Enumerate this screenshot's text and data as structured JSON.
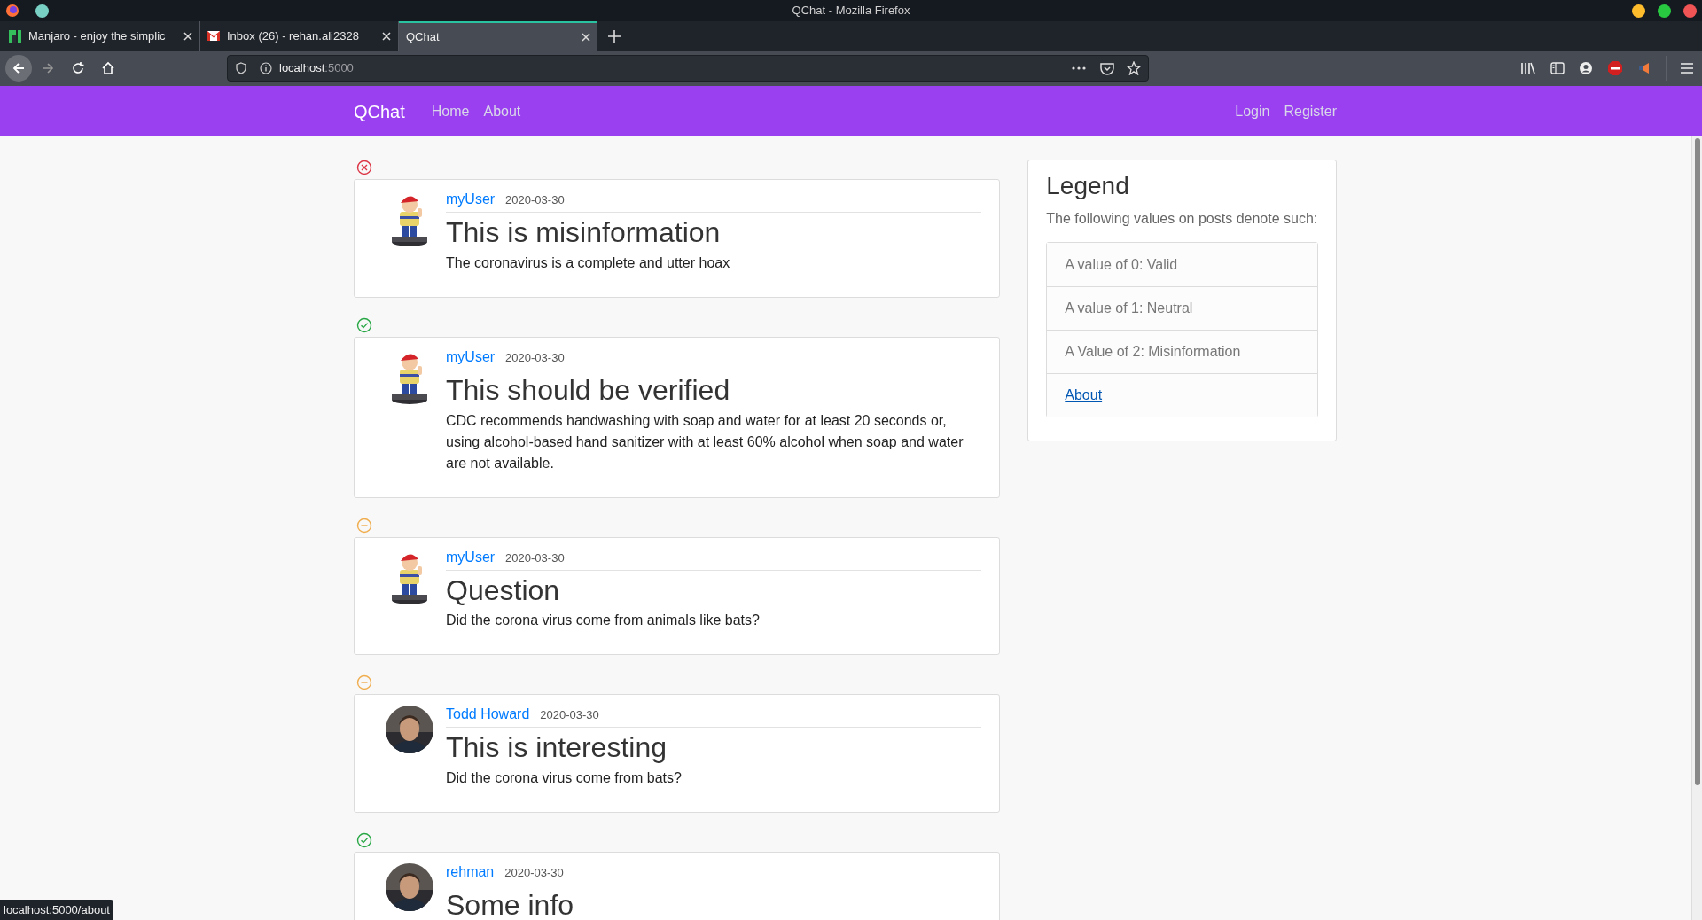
{
  "window": {
    "title": "QChat - Mozilla Firefox"
  },
  "tabs": [
    {
      "label": "Manjaro - enjoy the simplic",
      "selected": false
    },
    {
      "label": "Inbox (26) - rehan.ali2328",
      "selected": false
    },
    {
      "label": "QChat",
      "selected": true
    }
  ],
  "address_bar": {
    "host": "localhost",
    "port": ":5000"
  },
  "navbar": {
    "brand": "QChat",
    "left_links": [
      "Home",
      "About"
    ],
    "right_links": [
      "Login",
      "Register"
    ]
  },
  "posts": [
    {
      "kind": "invalid",
      "author": "myUser",
      "date": "2020-03-30",
      "title": "This is misinformation",
      "body": "The coronavirus is a complete and utter hoax"
    },
    {
      "kind": "valid",
      "author": "myUser",
      "date": "2020-03-30",
      "title": "This should be verified",
      "body": "CDC recommends handwashing with soap and water for at least 20 seconds or, using alcohol-based hand sanitizer with at least 60% alcohol when soap and water are not available."
    },
    {
      "kind": "neutral",
      "author": "myUser",
      "date": "2020-03-30",
      "title": "Question",
      "body": "Did the corona virus come from animals like bats?"
    },
    {
      "kind": "neutral",
      "author": "Todd Howard",
      "date": "2020-03-30",
      "title": "This is interesting",
      "body": "Did the corona virus come from bats?"
    },
    {
      "kind": "valid",
      "author": "rehman",
      "date": "2020-03-30",
      "title": "Some info"
    }
  ],
  "legend": {
    "title": "Legend",
    "subtitle": "The following values on posts denote such:",
    "items": [
      {
        "kind": "text",
        "label": "A value of 0: Valid"
      },
      {
        "kind": "text",
        "label": "A value of 1: Neutral"
      },
      {
        "kind": "text",
        "label": "A Value of 2: Misinformation"
      },
      {
        "kind": "link",
        "label": "About"
      }
    ]
  },
  "status_bar": {
    "url": "localhost:5000/about"
  }
}
